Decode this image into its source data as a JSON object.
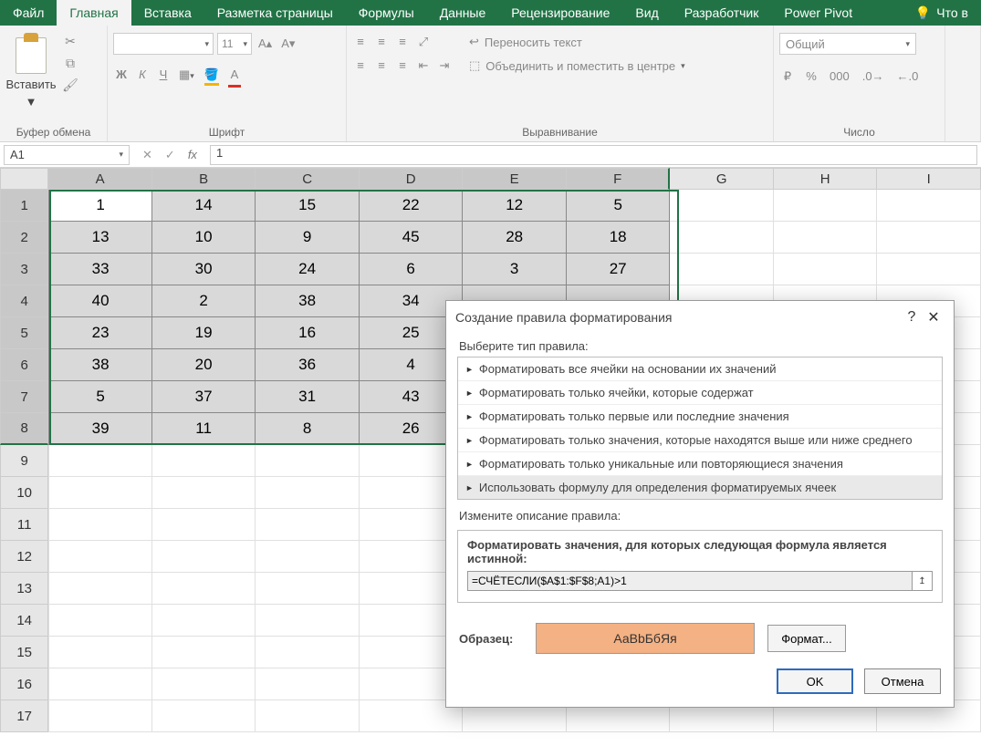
{
  "tabs": {
    "file": "Файл",
    "home": "Главная",
    "insert": "Вставка",
    "layout": "Разметка страницы",
    "formulas": "Формулы",
    "data": "Данные",
    "review": "Рецензирование",
    "view": "Вид",
    "developer": "Разработчик",
    "powerpivot": "Power Pivot",
    "tellme": "Что в"
  },
  "ribbon": {
    "paste": "Вставить",
    "clipboard_label": "Буфер обмена",
    "font_label": "Шрифт",
    "align_label": "Выравнивание",
    "number_label": "Число",
    "font_size": "11",
    "bold": "Ж",
    "italic": "К",
    "underline": "Ч",
    "wrap": "Переносить текст",
    "merge": "Объединить и поместить в центре",
    "number_format": "Общий"
  },
  "namebox": "A1",
  "formula": "1",
  "columns": [
    "A",
    "B",
    "C",
    "D",
    "E",
    "F",
    "G",
    "H",
    "I"
  ],
  "rows": [
    "1",
    "2",
    "3",
    "4",
    "5",
    "6",
    "7",
    "8",
    "9",
    "10",
    "11",
    "12",
    "13",
    "14",
    "15",
    "16",
    "17"
  ],
  "grid": [
    [
      "1",
      "14",
      "15",
      "22",
      "12",
      "5"
    ],
    [
      "13",
      "10",
      "9",
      "45",
      "28",
      "18"
    ],
    [
      "33",
      "30",
      "24",
      "6",
      "3",
      "27"
    ],
    [
      "40",
      "2",
      "38",
      "34",
      "",
      ""
    ],
    [
      "23",
      "19",
      "16",
      "25",
      "",
      ""
    ],
    [
      "38",
      "20",
      "36",
      "4",
      "",
      ""
    ],
    [
      "5",
      "37",
      "31",
      "43",
      "",
      ""
    ],
    [
      "39",
      "11",
      "8",
      "26",
      "",
      ""
    ]
  ],
  "dialog": {
    "title": "Создание правила форматирования",
    "select_type": "Выберите тип правила:",
    "rules": [
      "Форматировать все ячейки на основании их значений",
      "Форматировать только ячейки, которые содержат",
      "Форматировать только первые или последние значения",
      "Форматировать только значения, которые находятся выше или ниже среднего",
      "Форматировать только уникальные или повторяющиеся значения",
      "Использовать формулу для определения форматируемых ячеек"
    ],
    "edit_desc": "Измените описание правила:",
    "formula_label": "Форматировать значения, для которых следующая формула является истинной:",
    "formula_value": "=СЧЁТЕСЛИ($A$1:$F$8;A1)>1",
    "preview_label": "Образец:",
    "preview_text": "АаВbБбЯя",
    "format_btn": "Формат...",
    "ok": "OK",
    "cancel": "Отмена"
  }
}
